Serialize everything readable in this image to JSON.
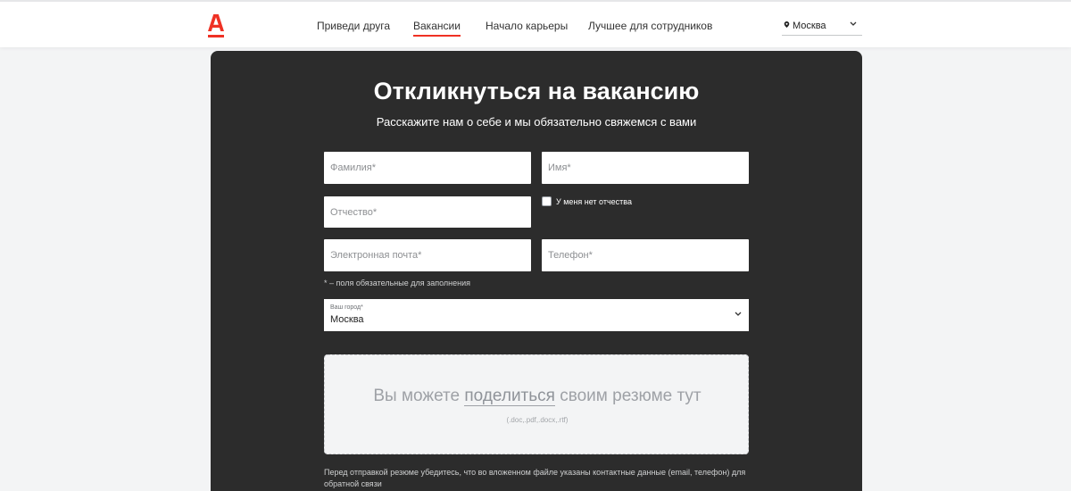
{
  "header": {
    "nav": [
      {
        "label": "Приведи друга",
        "active": false
      },
      {
        "label": "Вакансии",
        "active": true
      },
      {
        "label": "Начало карьеры",
        "active": false
      },
      {
        "label": "Лучшее для сотрудников",
        "active": false
      }
    ],
    "city": "Москва"
  },
  "form": {
    "title": "Откликнуться на вакансию",
    "subtitle": "Расскажите нам о себе и мы обязательно свяжемся с вами",
    "fields": {
      "last_name_placeholder": "Фамилия*",
      "first_name_placeholder": "Имя*",
      "middle_name_placeholder": "Отчество*",
      "email_placeholder": "Электронная почта*",
      "phone_placeholder": "Телефон*"
    },
    "no_middle_name_label": "У меня нет отчества",
    "required_note": "* – поля обязательные для заполнения",
    "city_select": {
      "caption": "Ваш город*",
      "value": "Москва"
    },
    "resume": {
      "text_before": "Вы можете ",
      "link": "поделиться",
      "text_after": " своим резюме тут",
      "formats": "(.doc,.pdf,.docx,.rtf)"
    },
    "footer_note": "Перед отправкой резюме убедитесь, что во вложенном файле указаны контактные данные (email, телефон) для обратной связи"
  },
  "colors": {
    "brand_red": "#ef3124",
    "panel_bg": "#2c2c2c",
    "page_bg": "#f3f4f5"
  }
}
